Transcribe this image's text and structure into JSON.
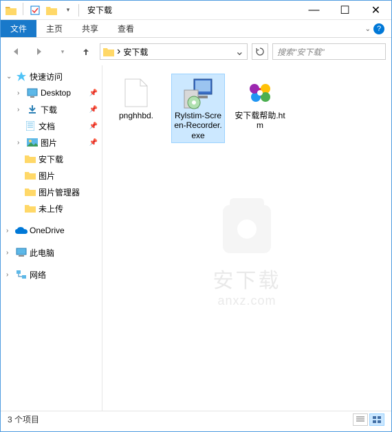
{
  "window": {
    "title": "安下载",
    "minimize": "—",
    "maximize": "☐",
    "close": "✕"
  },
  "ribbon": {
    "tabs": [
      "文件",
      "主页",
      "共享",
      "查看"
    ],
    "active": 0,
    "help": "?"
  },
  "address": {
    "separator": "›",
    "path": "安下载",
    "search_placeholder": "搜索\"安下载\""
  },
  "sidebar": {
    "quick_access": "快速访问",
    "items": [
      {
        "label": "Desktop",
        "icon": "desktop",
        "pinned": true
      },
      {
        "label": "下载",
        "icon": "downloads",
        "pinned": true
      },
      {
        "label": "文档",
        "icon": "documents",
        "pinned": true
      },
      {
        "label": "图片",
        "icon": "pictures",
        "pinned": true
      },
      {
        "label": "安下载",
        "icon": "folder",
        "pinned": false
      },
      {
        "label": "图片",
        "icon": "folder",
        "pinned": false
      },
      {
        "label": "图片管理器",
        "icon": "folder",
        "pinned": false
      },
      {
        "label": "未上传",
        "icon": "folder",
        "pinned": false
      }
    ],
    "onedrive": "OneDrive",
    "thispc": "此电脑",
    "network": "网络"
  },
  "files": [
    {
      "name": "pnghhbd.",
      "type": "blank",
      "selected": false
    },
    {
      "name": "Rylstim-Screen-Recorder.exe",
      "type": "exe",
      "selected": true
    },
    {
      "name": "安下载帮助.htm",
      "type": "htm",
      "selected": false
    }
  ],
  "watermark": {
    "line1": "安下载",
    "line2": "anxz.com"
  },
  "status": {
    "text": "3 个项目"
  }
}
